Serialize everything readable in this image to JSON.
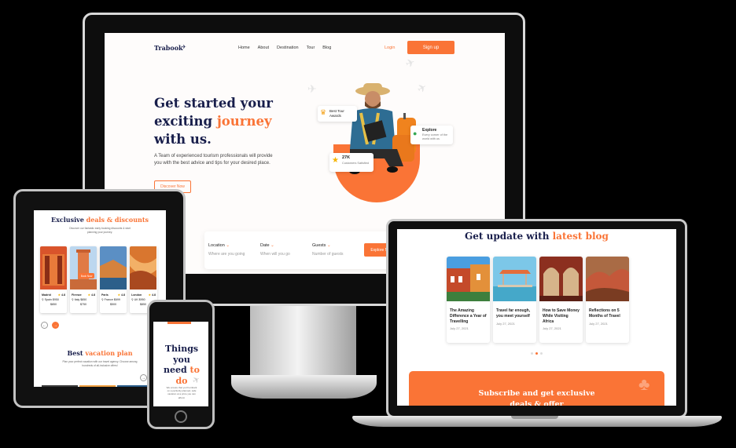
{
  "desktop": {
    "logo": "Trabook",
    "nav": [
      "Home",
      "About",
      "Destination",
      "Tour",
      "Blog"
    ],
    "login": "Login",
    "signup": "Sign up",
    "hero_line1": "Get started your",
    "hero_line2a": "exciting ",
    "hero_line2b": "journey",
    "hero_line3": "with us.",
    "hero_text": "A Team of experienced tourism professionals will provide you with the best advice and tips for your desired place.",
    "hero_button": "Discover Now",
    "badge_awards": "Best Tour Awards",
    "badge_explore_title": "Explore",
    "badge_explore_text": "Every corner of the world with us",
    "badge_count": "27K",
    "badge_count_text": "Customers Satisfied",
    "search": [
      {
        "label": "Location",
        "placeholder": "Where are you going"
      },
      {
        "label": "Date",
        "placeholder": "When will you go"
      },
      {
        "label": "Guests",
        "placeholder": "Number of guests"
      }
    ],
    "explore_button": "Explore Now"
  },
  "laptop": {
    "heading_a": "Get update with ",
    "heading_b": "latest blog",
    "posts": [
      {
        "title": "The Amazing Difference a Year of Travelling",
        "date": "July 27, 2021"
      },
      {
        "title": "Travel far enough, you meet yourself",
        "date": "July 27, 2021"
      },
      {
        "title": "How to Save Money While Visiting Africa",
        "date": "July 27, 2021"
      },
      {
        "title": "Reflections on 5 Months of Travel",
        "date": "July 27, 2021"
      }
    ],
    "subscribe_line1": "Subscribe and get exclusive",
    "subscribe_line2": "deals & offer"
  },
  "tablet": {
    "heading_a": "Exclusive ",
    "heading_b": "deals & discounts",
    "subtext": "Discover our fantastic early booking discounts & start planning your journey.",
    "book_label": "Book Now",
    "deals": [
      {
        "city": "Madrid",
        "rating": "4.8",
        "country": "Spain",
        "price": "$950",
        "old": "$850"
      },
      {
        "city": "Firenze",
        "rating": "4.8",
        "country": "Italy",
        "price": "$850",
        "old": "$750"
      },
      {
        "city": "Paris",
        "rating": "4.8",
        "country": "France",
        "price": "$699",
        "old": "$500"
      },
      {
        "city": "London",
        "rating": "4.8",
        "country": "UK",
        "price": "$950",
        "old": "$850"
      }
    ],
    "vacation_a": "Best ",
    "vacation_b": "vacation plan",
    "vacation_text": "Plan your perfect vacation with our travel agency. Choose among hundreds of all-inclusive offers!"
  },
  "phone": {
    "line1": "Things",
    "line2": "you",
    "line3a": "need ",
    "line3b": "to",
    "line4": "do",
    "text": "We ensure that you'll embark on a perfectly planned, safe vacation at a price you can afford."
  }
}
